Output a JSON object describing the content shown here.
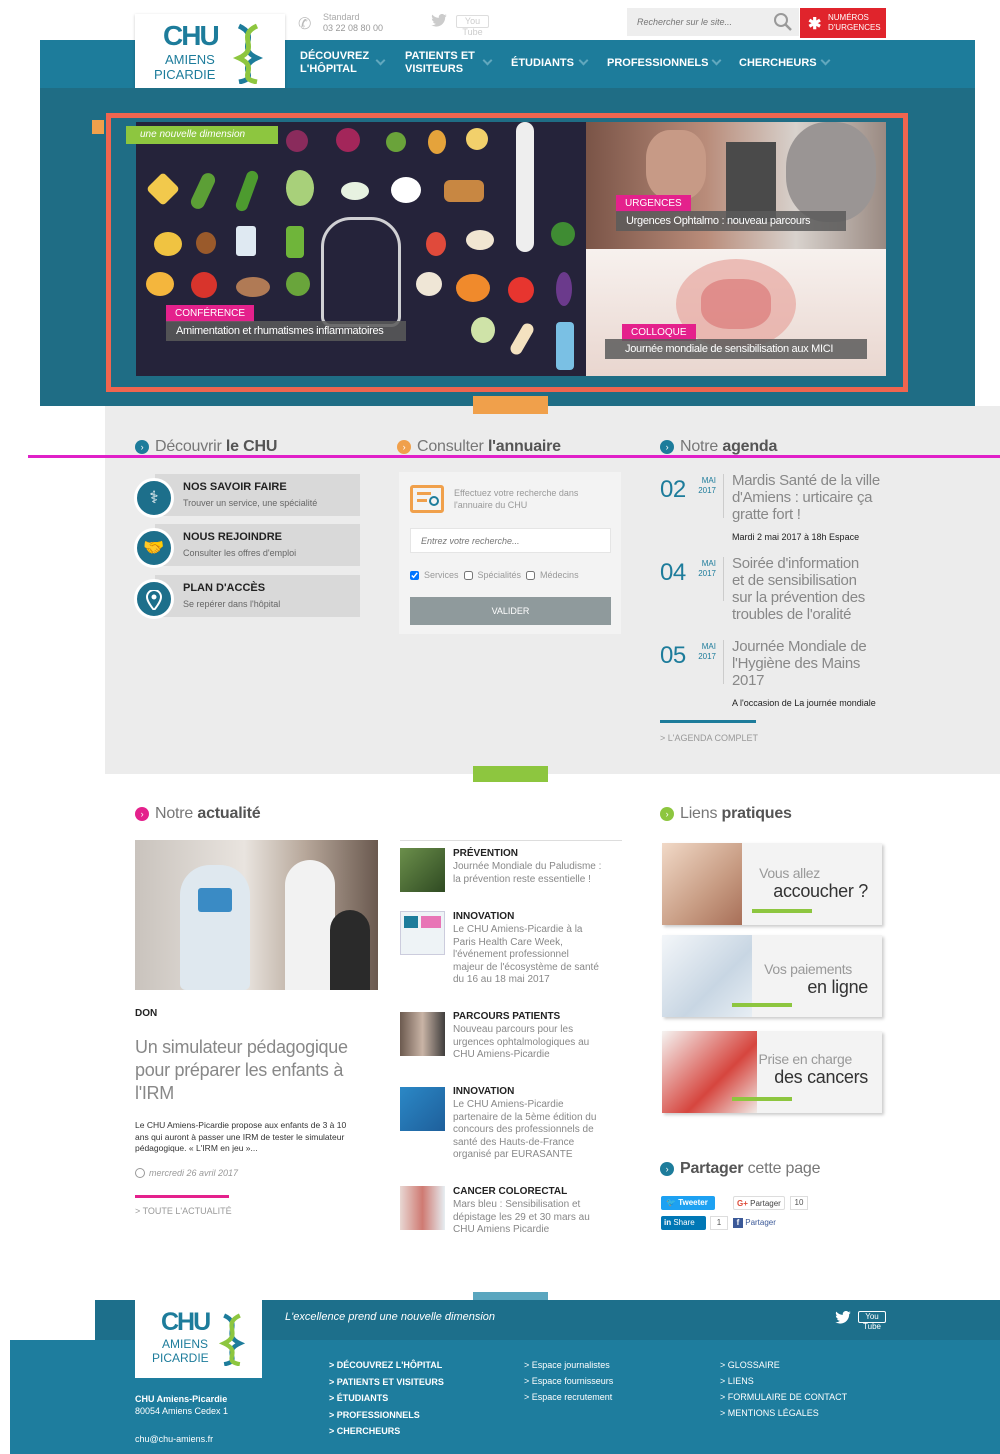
{
  "header": {
    "logo": {
      "line1": "CHU",
      "line2": "AMIENS",
      "line3": "PICARDIE"
    },
    "standard_label": "Standard",
    "phone": "03 22 08 80 00",
    "youtube_label": "You Tube",
    "search_placeholder": "Rechercher sur le site...",
    "emergency_line1": "NUMÉROS",
    "emergency_line2": "D'URGENCES"
  },
  "nav": {
    "items": [
      {
        "line1": "DÉCOUVREZ",
        "line2": "L'HÔPITAL"
      },
      {
        "line1": "PATIENTS ET",
        "line2": "VISITEURS"
      },
      {
        "line1": "ÉTUDIANTS",
        "line2": ""
      },
      {
        "line1": "PROFESSIONNELS",
        "line2": ""
      },
      {
        "line1": "CHERCHEURS",
        "line2": ""
      }
    ]
  },
  "hero": {
    "tagline": "une nouvelle dimension",
    "slide1": {
      "category": "CONFÉRENCE",
      "title": "Amimentation et rhumatismes inflammatoires"
    },
    "slide2": {
      "category": "URGENCES",
      "title": "Urgences Ophtalmo : nouveau parcours"
    },
    "slide3": {
      "category": "COLLOQUE",
      "title": "Journée mondiale de sensibilisation aux MICI"
    }
  },
  "discover": {
    "title_light": "Découvrir",
    "title_bold": "le CHU",
    "cards": [
      {
        "title": "NOS SAVOIR FAIRE",
        "subtitle": "Trouver un service, une spécialité"
      },
      {
        "title": "NOUS REJOINDRE",
        "subtitle": "Consulter les offres d'emploi"
      },
      {
        "title": "PLAN D'ACCÈS",
        "subtitle": "Se repérer dans l'hôpital"
      }
    ]
  },
  "directory": {
    "title_light": "Consulter",
    "title_bold": "l'annuaire",
    "intro_line1": "Effectuez votre recherche dans",
    "intro_line2": "l'annuaire du CHU",
    "search_placeholder": "Entrez votre recherche...",
    "filters": [
      {
        "label": "Services",
        "checked": true
      },
      {
        "label": "Spécialités",
        "checked": false
      },
      {
        "label": "Médecins",
        "checked": false
      }
    ],
    "submit_label": "VALIDER"
  },
  "agenda": {
    "title_light": "Notre",
    "title_bold": "agenda",
    "events": [
      {
        "day": "02",
        "month": "MAI",
        "year": "2017",
        "title_lines": [
          "Mardis Santé de la ville",
          "d'Amiens : urticaire ça",
          "gratte fort !"
        ],
        "subtitle": "Mardi 2 mai 2017 à 18h Espace"
      },
      {
        "day": "04",
        "month": "MAI",
        "year": "2017",
        "title_lines": [
          "Soirée d'information",
          "et de sensibilisation",
          "sur la prévention des",
          "troubles de l'oralité"
        ],
        "subtitle": ""
      },
      {
        "day": "05",
        "month": "MAI",
        "year": "2017",
        "title_lines": [
          "Journée Mondiale de",
          "l'Hygiène des Mains",
          "2017"
        ],
        "subtitle": "A l'occasion de La journée mondiale"
      }
    ],
    "full_link": "> L'AGENDA COMPLET"
  },
  "news": {
    "title_light": "Notre",
    "title_bold": "actualité",
    "featured": {
      "category": "DON",
      "title_lines": [
        "Un simulateur pédagogique",
        "pour préparer les enfants à",
        "l'IRM"
      ],
      "summary_lines": [
        "Le CHU Amiens-Picardie propose aux enfants de 3 à 10",
        "ans qui auront à passer une IRM de tester le simulateur",
        "pédagogique. « L'IRM en jeu »..."
      ],
      "date": "mercredi 26 avril 2017"
    },
    "items": [
      {
        "category": "PRÉVENTION",
        "text_lines": [
          "Journée Mondiale du Paludisme :",
          "la prévention reste essentielle !"
        ]
      },
      {
        "category": "INNOVATION",
        "text_lines": [
          "Le CHU Amiens-Picardie à la",
          "Paris Health Care Week,",
          "l'événement professionnel",
          "majeur de l'écosystème de santé",
          "du 16 au 18 mai 2017"
        ]
      },
      {
        "category": "PARCOURS PATIENTS",
        "text_lines": [
          "Nouveau parcours pour les",
          "urgences ophtalmologiques au",
          "CHU Amiens-Picardie"
        ]
      },
      {
        "category": "INNOVATION",
        "text_lines": [
          "Le CHU Amiens-Picardie",
          "partenaire de la 5ème édition du",
          "concours des professionnels de",
          "santé des Hauts-de-France",
          "organisé par EURASANTE"
        ]
      },
      {
        "category": "CANCER COLORECTAL",
        "text_lines": [
          "Mars bleu : Sensibilisation et",
          "dépistage les 29 et 30 mars au",
          "CHU Amiens Picardie"
        ]
      }
    ],
    "all_link": "> TOUTE L'ACTUALITÉ"
  },
  "links": {
    "title_light": "Liens",
    "title_bold": "pratiques",
    "items": [
      {
        "line1": "Vous allez",
        "line2": "accoucher ?"
      },
      {
        "line1": "Vos paiements",
        "line2": "en ligne"
      },
      {
        "line1": "Prise en charge",
        "line2": "des cancers"
      }
    ]
  },
  "share": {
    "title_bold": "Partager",
    "title_light": "cette page",
    "tweet_label": "Tweeter",
    "gplus_label": "Partager",
    "gplus_count": "10",
    "linkedin_label": "Share",
    "linkedin_count": "1",
    "facebook_label": "Partager"
  },
  "footer": {
    "tagline": "L'excellence prend une nouvelle dimension",
    "org_name": "CHU Amiens-Picardie",
    "address": "80054 Amiens Cedex 1",
    "email": "chu@chu-amiens.fr",
    "col1": [
      "> DÉCOUVREZ L'HÔPITAL",
      "> PATIENTS ET VISITEURS",
      "> ÉTUDIANTS",
      "> PROFESSIONNELS",
      "> CHERCHEURS"
    ],
    "col2": [
      "> Espace journalistes",
      "> Espace fournisseurs",
      "> Espace recrutement"
    ],
    "col3": [
      "> GLOSSAIRE",
      "> LIENS",
      "> FORMULAIRE DE CONTACT",
      "> MENTIONS LÉGALES"
    ]
  },
  "colors": {
    "primary": "#1d7c9b",
    "hero_frame": "#f0654f",
    "accent_pink": "#e4218c",
    "accent_green": "#8dc63f",
    "accent_orange": "#f0a04b",
    "emergency_red": "#e0242c",
    "guide_line": "#e020c8"
  }
}
